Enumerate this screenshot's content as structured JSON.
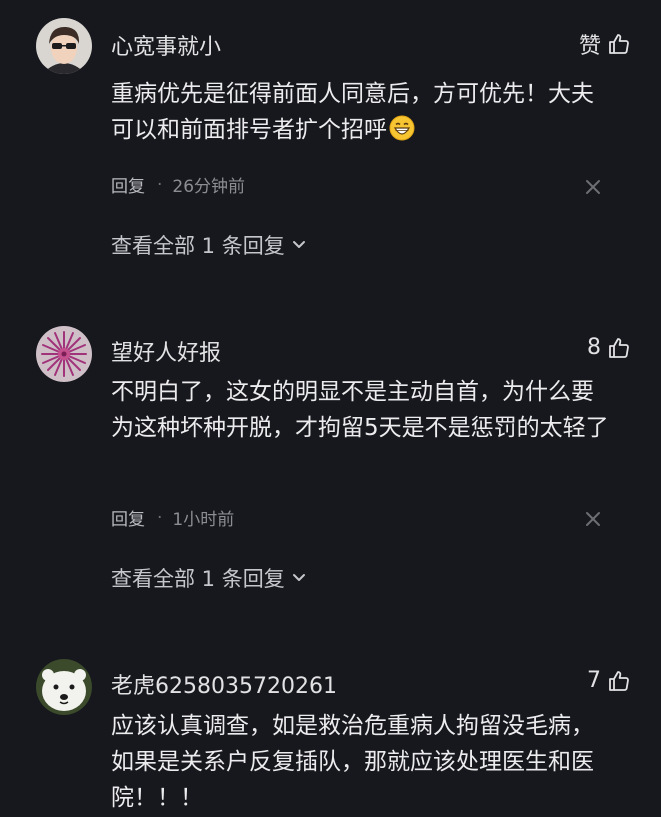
{
  "comments": [
    {
      "username": "心宽事就小",
      "like_label": "赞",
      "text": "重病优先是征得前面人同意后，方可优先！大夫可以和前面排号者扩个招呼",
      "emoji": "grinning-face-emoji",
      "reply_label": "回复",
      "separator": "·",
      "time": "26分钟前",
      "view_replies": "查看全部 1 条回复"
    },
    {
      "username": "望好人好报",
      "like_label": "8",
      "text": "不明白了，这女的明显不是主动自首，为什么要为这种坏种开脱，才拘留5天是不是惩罚的太轻了",
      "reply_label": "回复",
      "separator": "·",
      "time": "1小时前",
      "view_replies": "查看全部 1 条回复"
    },
    {
      "username": "老虎6258035720261",
      "like_label": "7",
      "text": "应该认真调查，如是救治危重病人拘留没毛病，如果是关系户反复插队，那就应该处理医生和医院！！！"
    }
  ],
  "icons": {
    "like": "thumbs-up-icon",
    "close": "close-icon",
    "chevron": "chevron-down-icon"
  },
  "colors": {
    "background": "#17181d",
    "text": "#ececee",
    "muted": "#8c8d93"
  }
}
